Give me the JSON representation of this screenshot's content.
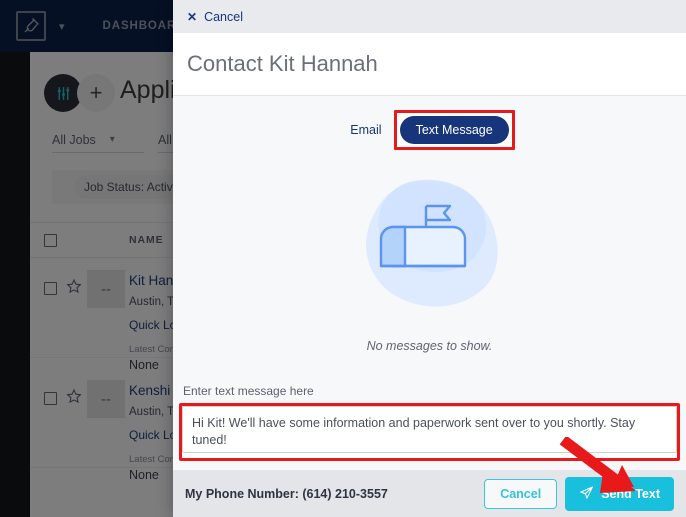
{
  "topnav": {
    "logo_icon": "plug-logo-icon",
    "caret_icon": "chevron-down-icon",
    "dashboard_label": "DASHBOARD",
    "background_color": "#0d2149"
  },
  "background_page": {
    "filter_icon": "sliders-icon",
    "add_label": "+",
    "title": "Applicants",
    "filters": [
      {
        "label": "All Jobs",
        "caret": "chevron-down-icon"
      },
      {
        "label": "All",
        "caret": "chevron-down-icon"
      }
    ],
    "chip": {
      "label": "Job Status: Active",
      "close": "✕"
    },
    "table": {
      "columns": [
        "NAME"
      ],
      "rows": [
        {
          "name": "Kit Hannah",
          "location": "Austin, TX",
          "link": "Quick Look",
          "meta_label": "Latest Comment",
          "meta_value": "None",
          "avatar_initials": "--",
          "star_icon": "star-outline-icon"
        },
        {
          "name": "Kenshi T",
          "location": "Austin, TX",
          "link": "Quick Look",
          "meta_label": "Latest Comment",
          "meta_value": "None",
          "avatar_initials": "--",
          "star_icon": "star-outline-icon"
        }
      ]
    }
  },
  "modal": {
    "cancel_top": {
      "icon": "close-icon",
      "label": "Cancel"
    },
    "title": "Contact Kit Hannah",
    "tabs": {
      "email_label": "Email",
      "text_label": "Text Message",
      "active": "Text Message",
      "active_color": "#17357a"
    },
    "empty_state": {
      "illustration": "mailbox-icon",
      "message": "No messages to show."
    },
    "compose": {
      "label": "Enter text message here",
      "value": "Hi Kit! We'll have some information and paperwork sent over to you shortly. Stay tuned!",
      "placeholder": "Enter text message here"
    },
    "footer": {
      "phone_label": "My Phone Number: (614) 210-3557",
      "cancel_label": "Cancel",
      "send_label": "Send Text",
      "send_icon": "paper-plane-icon",
      "send_color": "#18c0dd",
      "cancel_border_color": "#38c6e0"
    }
  },
  "annotations": {
    "highlight_color": "#e8191b",
    "arrow_color": "#e8191b"
  }
}
